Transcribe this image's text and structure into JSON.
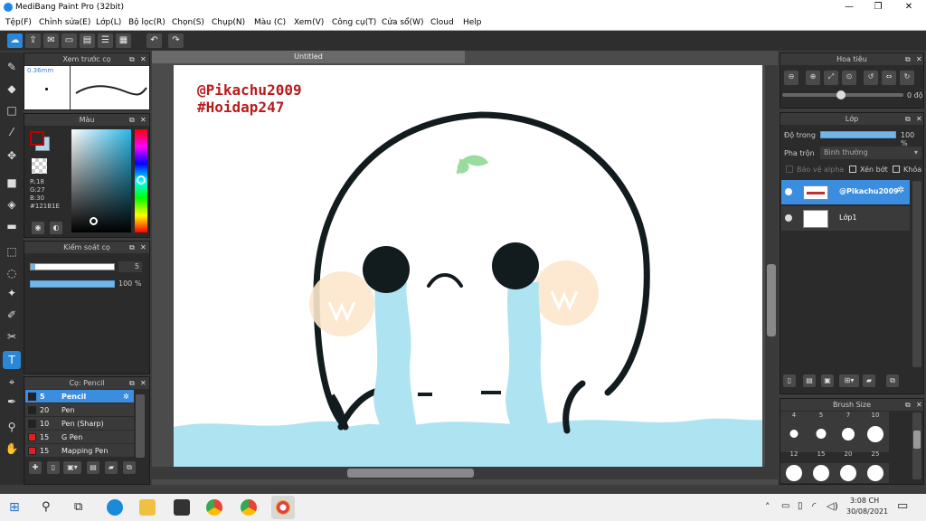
{
  "window": {
    "title": "MediBang Paint Pro (32bit)",
    "minimize": "—",
    "maximize": "❐",
    "close": "✕"
  },
  "menu": [
    "Tệp(F)",
    "Chỉnh sửa(E)",
    "Lớp(L)",
    "Bộ lọc(R)",
    "Chọn(S)",
    "Chụp(N)",
    "Màu (C)",
    "Xem(V)",
    "Công cụ(T)",
    "Cửa sổ(W)",
    "Cloud",
    "Help"
  ],
  "document": {
    "tab": "Untitled",
    "text1": "@Pikachu2009",
    "text2": "#Hoidap247"
  },
  "preview_panel": {
    "title": "Xem trước cọ",
    "size": "0.36mm"
  },
  "color_panel": {
    "title": "Màu",
    "r": "R:18",
    "g": "G:27",
    "b": "B:30",
    "hex": "#121B1E",
    "primary": "#c00000",
    "secondary": "#a9d7f0"
  },
  "control_panel": {
    "title": "Kiểm soát cọ",
    "size_value": "5",
    "opacity_value": "100 %",
    "opacity_fraction": 1.0
  },
  "brush_panel": {
    "title": "Cọ: Pencil",
    "brushes": [
      {
        "size": "5",
        "name": "Pencil",
        "color": "#222222"
      },
      {
        "size": "20",
        "name": "Pen",
        "color": "#222222"
      },
      {
        "size": "10",
        "name": "Pen (Sharp)",
        "color": "#222222"
      },
      {
        "size": "15",
        "name": "G Pen",
        "color": "#e02020"
      },
      {
        "size": "15",
        "name": "Mapping Pen",
        "color": "#e02020"
      }
    ]
  },
  "navigator": {
    "title": "Hoa tiêu",
    "angle": "0 độ"
  },
  "layer_panel": {
    "title": "Lớp",
    "opacity_label": "Độ trong",
    "opacity_value": "100 %",
    "opacity_fraction": 1.0,
    "blend_label": "Pha trộn",
    "blend_value": "Bình thường",
    "protect_alpha": "Bảo vệ alpha",
    "clipping": "Xén bớt",
    "lock": "Khóa",
    "layers": [
      {
        "name": "@Pikachu2009"
      },
      {
        "name": "Lớp1"
      }
    ]
  },
  "brush_size": {
    "title": "Brush Size",
    "sizes": [
      "4",
      "5",
      "7",
      "10",
      "12",
      "15",
      "20",
      "25"
    ]
  },
  "taskbar": {
    "time": "3:08 CH",
    "date": "30/08/2021"
  }
}
